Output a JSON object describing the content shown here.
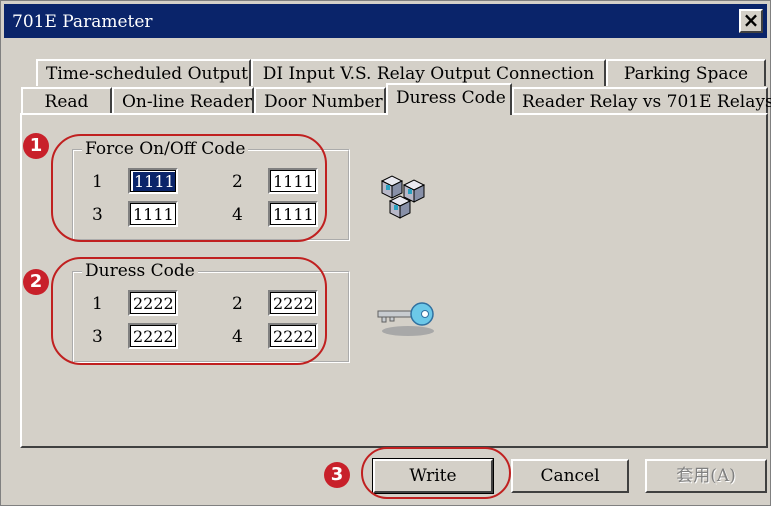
{
  "window": {
    "title": "701E Parameter",
    "close_label": "×"
  },
  "tabs_row_back": [
    "Time-scheduled Output",
    "DI Input  V.S. Relay Output Connection",
    "Parking Space"
  ],
  "tabs_row_front": [
    "Read",
    "On-line Reader",
    "Door Number",
    "Duress Code",
    "Reader Relay vs 701E Relays"
  ],
  "active_tab": "Duress Code",
  "force_group": {
    "label": "Force On/Off Code",
    "entries": [
      {
        "num": "1",
        "value": "1111"
      },
      {
        "num": "2",
        "value": "1111"
      },
      {
        "num": "3",
        "value": "1111"
      },
      {
        "num": "4",
        "value": "1111"
      }
    ]
  },
  "duress_group": {
    "label": "Duress Code",
    "entries": [
      {
        "num": "1",
        "value": "2222"
      },
      {
        "num": "2",
        "value": "2222"
      },
      {
        "num": "3",
        "value": "2222"
      },
      {
        "num": "4",
        "value": "2222"
      }
    ]
  },
  "buttons": {
    "write": "Write",
    "cancel": "Cancel",
    "apply": "套用(A)"
  },
  "annotations": {
    "step1": "1",
    "step2": "2",
    "step3": "3"
  },
  "colors": {
    "titlebar": "#0a246a",
    "annotation": "#c8202a"
  },
  "icons": {
    "force_icon": "cubes-icon",
    "duress_icon": "key-icon"
  }
}
